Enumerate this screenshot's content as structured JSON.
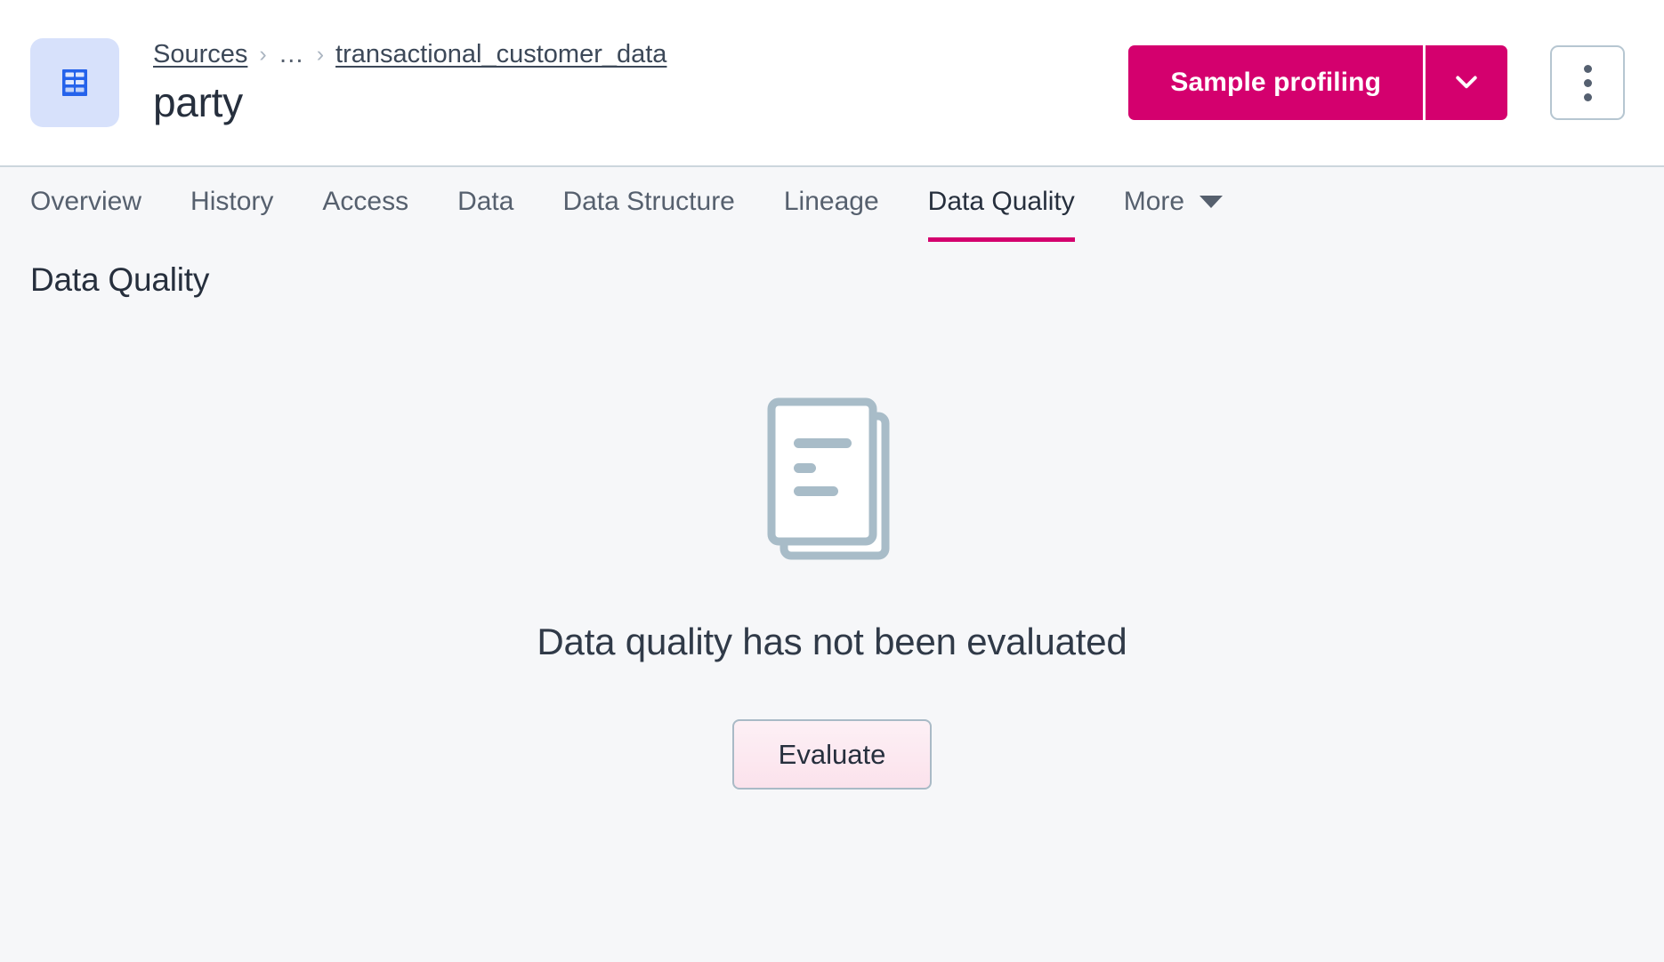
{
  "header": {
    "entity_icon": "table-icon",
    "breadcrumb": [
      {
        "label": "Sources",
        "type": "link"
      },
      {
        "label": "…",
        "type": "ellipsis"
      },
      {
        "label": "transactional_customer_data",
        "type": "link"
      }
    ],
    "separator": "›",
    "title": "party",
    "primary_action": "Sample profiling",
    "primary_action_caret_icon": "chevron-down-icon",
    "overflow_menu_icon": "kebab-menu-icon"
  },
  "tabs": [
    {
      "label": "Overview",
      "active": false
    },
    {
      "label": "History",
      "active": false
    },
    {
      "label": "Access",
      "active": false
    },
    {
      "label": "Data",
      "active": false
    },
    {
      "label": "Data Structure",
      "active": false
    },
    {
      "label": "Lineage",
      "active": false
    },
    {
      "label": "Data Quality",
      "active": true
    },
    {
      "label": "More",
      "active": false,
      "caret": true
    }
  ],
  "main": {
    "section_title": "Data Quality",
    "empty_state": {
      "illustration": "documents-stack-icon",
      "message": "Data quality has not been evaluated",
      "action_label": "Evaluate"
    }
  },
  "colors": {
    "accent_magenta": "#d4006e",
    "icon_tile_bg": "#d7e1fb",
    "icon_blue": "#2563eb",
    "page_bg": "#f6f7f9",
    "header_bg": "#ffffff",
    "text_primary": "#262f3d",
    "text_muted": "#56606e",
    "illustration_gray": "#a8bcc8",
    "border": "#ccd6dd"
  }
}
